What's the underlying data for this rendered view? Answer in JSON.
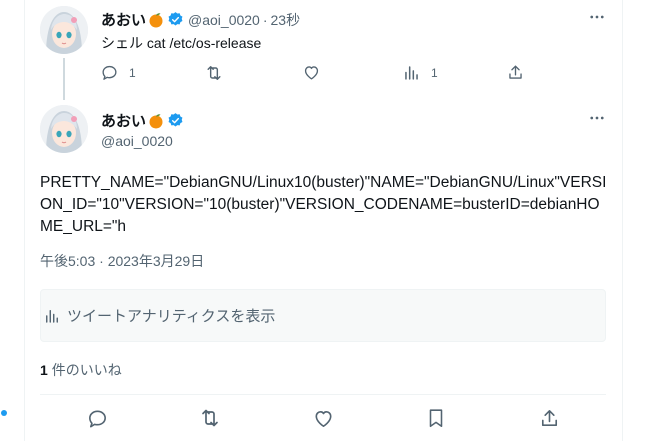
{
  "colors": {
    "text_primary": "#0f1419",
    "text_secondary": "#536471",
    "verified_blue": "#1d9bf0",
    "thread_line": "#cfd9de",
    "divider": "#eff3f4",
    "analytics_bg": "#f7f9f9",
    "emoji_orange": "#f4900c"
  },
  "reply_tweet": {
    "display_name": "あおい",
    "emoji_icon": "tangerine-emoji",
    "verified_icon": "verified-badge-icon",
    "handle": "@aoi_0020",
    "separator": "·",
    "time": "23秒",
    "text": "シェル cat /etc/os-release",
    "actions": {
      "reply_count": "1",
      "retweet_count": "",
      "like_count": "",
      "views_count": "1"
    }
  },
  "main_tweet": {
    "display_name": "あおい",
    "handle": "@aoi_0020",
    "text": "PRETTY_NAME=\"DebianGNU/Linux10(buster)\"NAME=\"DebianGNU/Linux\"VERSION_ID=\"10\"VERSION=\"10(buster)\"VERSION_CODENAME=busterID=debianHOME_URL=\"h",
    "timestamp": "午後5:03 · 2023年3月29日",
    "analytics_label": "ツイートアナリティクスを表示",
    "likes_count": "1",
    "likes_label": "件のいいね"
  }
}
